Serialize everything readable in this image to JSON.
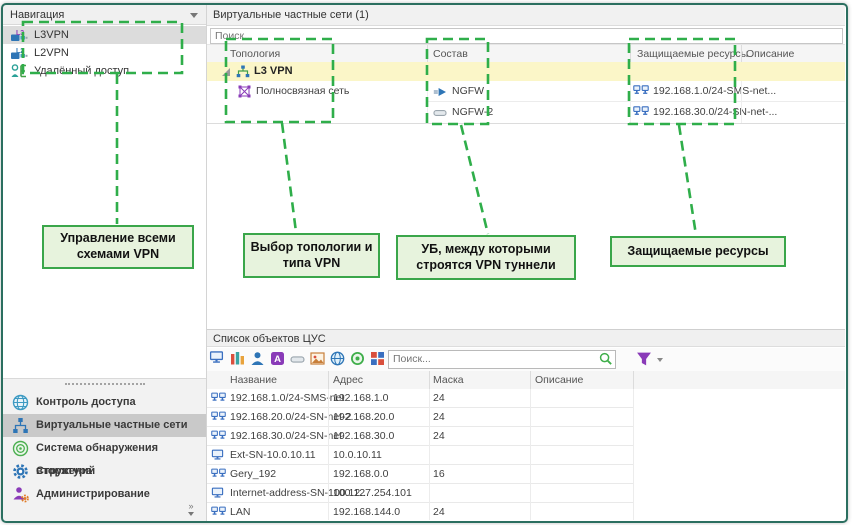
{
  "sidebar": {
    "header": "Навигация",
    "tree": [
      {
        "label": "L3VPN",
        "badge": "L3"
      },
      {
        "label": "L2VPN",
        "badge": "L2"
      },
      {
        "label": "Удалённый доступ",
        "badge": ""
      }
    ],
    "menu": [
      {
        "label": "Контроль доступа"
      },
      {
        "label": "Виртуальные частные сети"
      },
      {
        "label": "Система обнаружения вторжений"
      },
      {
        "label": "Структура"
      },
      {
        "label": "Администрирование"
      }
    ],
    "collapse_glyph": "»"
  },
  "vpn_panel": {
    "title": "Виртуальные частные сети (1)",
    "search_placeholder": "Поиск...",
    "columns": [
      "Топология",
      "Состав",
      "Защищаемые ресурсы",
      "Описание"
    ],
    "group_label": "L3 VPN",
    "topology_label": "Полносвязная сеть",
    "members": [
      {
        "label": "NGFW",
        "icon": "arrow-device-icon"
      },
      {
        "label": "NGFW-2",
        "icon": "box-device-icon"
      }
    ],
    "resources": [
      {
        "label": "192.168.1.0/24-SMS-net...",
        "icon": "network-icon"
      },
      {
        "label": "192.168.30.0/24-SN-net-...",
        "icon": "network-icon"
      }
    ]
  },
  "callouts": [
    {
      "text": "Управление всеми схемами VPN"
    },
    {
      "text": "Выбор топологии и типа VPN"
    },
    {
      "text": "УБ, между которыми строятся VPN туннели"
    },
    {
      "text": "Защищаемые ресурсы"
    }
  ],
  "objects_panel": {
    "title": "Список объектов ЦУС",
    "search_placeholder": "Поиск...",
    "columns": [
      "Название",
      "Адрес",
      "Маска",
      "Описание"
    ],
    "toolbar_icons": [
      "monitor-icon",
      "columns-icon",
      "user-icon",
      "letter-a-icon",
      "dash-icon",
      "image-icon",
      "globe-icon",
      "target-icon",
      "grid-icon",
      "search-icon",
      "filter-icon"
    ],
    "rows": [
      {
        "type": "network",
        "name": "192.168.1.0/24-SMS-net",
        "address": "192.168.1.0",
        "mask": "24",
        "description": ""
      },
      {
        "type": "network",
        "name": "192.168.20.0/24-SN-net-2",
        "address": "192.168.20.0",
        "mask": "24",
        "description": ""
      },
      {
        "type": "network",
        "name": "192.168.30.0/24-SN-net",
        "address": "192.168.30.0",
        "mask": "24",
        "description": ""
      },
      {
        "type": "host",
        "name": "Ext-SN-10.0.10.11",
        "address": "10.0.10.11",
        "mask": "",
        "description": ""
      },
      {
        "type": "network",
        "name": "Gery_192",
        "address": "192.168.0.0",
        "mask": "16",
        "description": ""
      },
      {
        "type": "host",
        "name": "Internet-address-SN-100.12...",
        "address": "100.127.254.101",
        "mask": "",
        "description": ""
      },
      {
        "type": "network",
        "name": "LAN",
        "address": "192.168.144.0",
        "mask": "24",
        "description": ""
      }
    ]
  },
  "colors": {
    "window_border": "#2b6f60",
    "annotation_green": "#2fae4a",
    "callout_bg": "#e7f3dd",
    "selection_yellow": "#fbf6c8",
    "icon_blue": "#2e75b6",
    "icon_purple": "#8a3bb8"
  }
}
